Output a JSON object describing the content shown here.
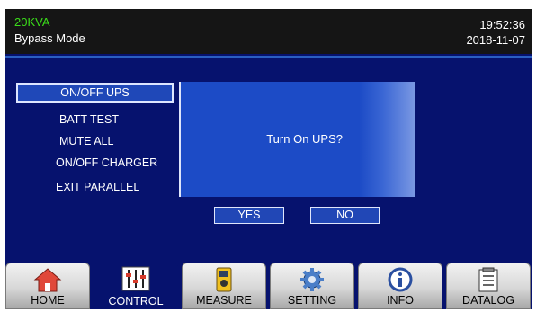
{
  "header": {
    "power_rating": "20KVA",
    "mode": "Bypass Mode",
    "time": "19:52:36",
    "date": "2018-11-07"
  },
  "menu": {
    "items": [
      {
        "label": "ON/OFF UPS",
        "selected": true
      },
      {
        "label": "BATT TEST"
      },
      {
        "label": "MUTE ALL"
      },
      {
        "label": "ON/OFF CHARGER"
      },
      {
        "label": "EXIT PARALLEL"
      }
    ]
  },
  "dialog": {
    "message": "Turn On UPS?",
    "yes_label": "YES",
    "no_label": "NO"
  },
  "tabs": [
    {
      "label": "HOME",
      "icon": "home-icon"
    },
    {
      "label": "CONTROL",
      "icon": "sliders-icon",
      "active": true
    },
    {
      "label": "MEASURE",
      "icon": "meter-icon"
    },
    {
      "label": "SETTING",
      "icon": "gear-icon"
    },
    {
      "label": "INFO",
      "icon": "info-icon"
    },
    {
      "label": "DATALOG",
      "icon": "clipboard-icon"
    }
  ],
  "colors": {
    "background": "#06126e",
    "panel": "#1c4bc6",
    "header": "#151515",
    "power_text": "#3bdc1a"
  }
}
